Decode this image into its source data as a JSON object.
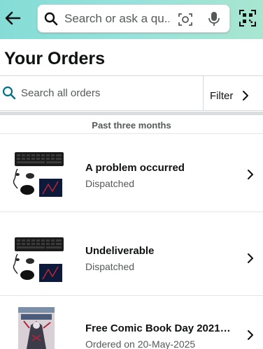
{
  "header": {
    "search_placeholder": "Search or ask a qu..."
  },
  "page": {
    "title": "Your Orders"
  },
  "orders_search": {
    "placeholder": "Search all orders",
    "filter_label": "Filter"
  },
  "section": {
    "label": "Past three months"
  },
  "orders": [
    {
      "title": "A problem occurred",
      "status": "Dispatched"
    },
    {
      "title": "Undeliverable",
      "status": "Dispatched"
    },
    {
      "title": "Free Comic Book Day 2021:...",
      "status": "Ordered on 20-May-2025"
    }
  ],
  "colors": {
    "header_gradient_start": "#85dcd6",
    "header_gradient_end": "#a8e6cf",
    "search_icon_accent": "#007185"
  }
}
